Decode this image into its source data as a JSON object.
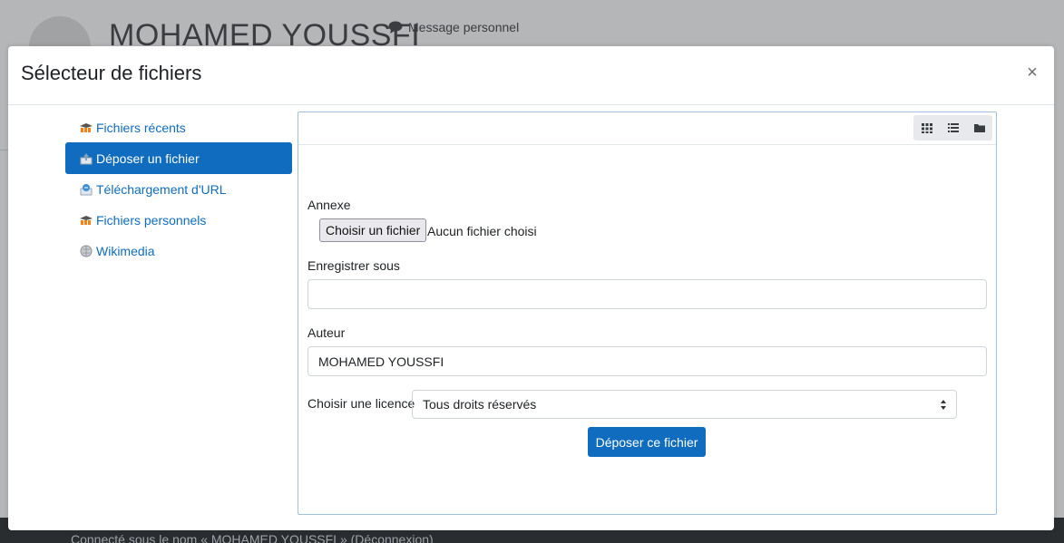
{
  "background": {
    "profile_name": "MOHAMED YOUSSFI",
    "message_link": "Message personnel",
    "footer_text": "Connecté sous le nom « MOHAMED YOUSSFI » (Déconnexion)"
  },
  "modal": {
    "title": "Sélecteur de fichiers",
    "close_symbol": "×"
  },
  "repositories": [
    {
      "label": "Fichiers récents",
      "icon": "moodle-icon",
      "active": false
    },
    {
      "label": "Déposer un fichier",
      "icon": "upload-icon",
      "active": true
    },
    {
      "label": "Téléchargement d'URL",
      "icon": "url-download-icon",
      "active": false
    },
    {
      "label": "Fichiers personnels",
      "icon": "moodle-icon",
      "active": false
    },
    {
      "label": "Wikimedia",
      "icon": "wikimedia-icon",
      "active": false
    }
  ],
  "toolbar": {
    "views": [
      "grid-view-icon",
      "list-view-icon",
      "folder-view-icon"
    ]
  },
  "upload_form": {
    "attachment_label": "Annexe",
    "choose_file_button": "Choisir un fichier",
    "no_file_text": "Aucun fichier choisi",
    "save_as_label": "Enregistrer sous",
    "save_as_value": "",
    "author_label": "Auteur",
    "author_value": "MOHAMED YOUSSFI",
    "license_label": "Choisir une licence",
    "license_value": "Tous droits réservés",
    "submit_button": "Déposer ce fichier"
  },
  "colors": {
    "primary": "#0f6cbf",
    "moodle_orange": "#f98012"
  }
}
